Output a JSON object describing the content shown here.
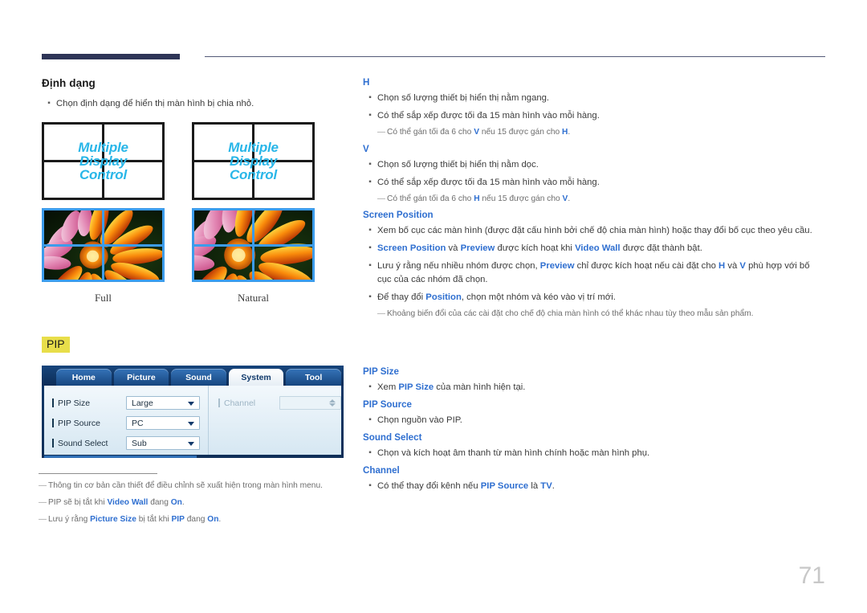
{
  "page": {
    "number": "71"
  },
  "left_column": {
    "section_title": "Định dạng",
    "bullets": [
      "Chọn định dạng để hiển thị màn hình bị chia nhỏ."
    ],
    "figure": {
      "wall_text_lines": [
        "Multiple",
        "Display",
        "Control"
      ],
      "captions": [
        "Full",
        "Natural"
      ]
    },
    "pip_badge": "PIP",
    "osd": {
      "tabs": [
        {
          "label": "Home",
          "active": false
        },
        {
          "label": "Picture",
          "active": false
        },
        {
          "label": "Sound",
          "active": false
        },
        {
          "label": "System",
          "active": true
        },
        {
          "label": "Tool",
          "active": false
        }
      ],
      "rows_left": [
        {
          "label": "PIP Size",
          "value": "Large"
        },
        {
          "label": "PIP Source",
          "value": "PC"
        },
        {
          "label": "Sound Select",
          "value": "Sub"
        }
      ],
      "rows_right": [
        {
          "label": "Channel",
          "value": ""
        }
      ]
    },
    "footnotes": [
      [
        {
          "t": "Thông tin cơ bản cần thiết để điều chỉnh sẽ xuất hiện trong màn hình menu.",
          "b": false
        }
      ],
      [
        {
          "t": "PIP sẽ bị tắt khi ",
          "b": false
        },
        {
          "t": "Video Wall",
          "b": true
        },
        {
          "t": " đang ",
          "b": false
        },
        {
          "t": "On",
          "b": true
        },
        {
          "t": ".",
          "b": false
        }
      ],
      [
        {
          "t": "Lưu ý rằng ",
          "b": false
        },
        {
          "t": "Picture Size",
          "b": true
        },
        {
          "t": " bị tắt khi ",
          "b": false
        },
        {
          "t": "PIP",
          "b": true
        },
        {
          "t": " đang ",
          "b": false
        },
        {
          "t": "On",
          "b": true
        },
        {
          "t": ".",
          "b": false
        }
      ]
    ]
  },
  "right_column": {
    "blocks": [
      {
        "heading": "H",
        "bullets": [
          [
            {
              "t": "Chọn số lượng thiết bị hiển thị nằm ngang.",
              "b": false
            }
          ],
          [
            {
              "t": "Có thể sắp xếp được tối đa 15 màn hình vào mỗi hàng.",
              "b": false
            }
          ]
        ],
        "notes": [
          [
            {
              "t": "Có thể gán tối đa 6 cho ",
              "b": false
            },
            {
              "t": "V",
              "b": true
            },
            {
              "t": " nếu 15 được gán cho ",
              "b": false
            },
            {
              "t": "H",
              "b": true
            },
            {
              "t": ".",
              "b": false
            }
          ]
        ]
      },
      {
        "heading": "V",
        "bullets": [
          [
            {
              "t": "Chọn số lượng thiết bị hiển thị nằm dọc.",
              "b": false
            }
          ],
          [
            {
              "t": "Có thể sắp xếp được tối đa 15 màn hình vào mỗi hàng.",
              "b": false
            }
          ]
        ],
        "notes": [
          [
            {
              "t": "Có thể gán tối đa 6 cho ",
              "b": false
            },
            {
              "t": "H",
              "b": true
            },
            {
              "t": " nếu 15 được gán cho ",
              "b": false
            },
            {
              "t": "V",
              "b": true
            },
            {
              "t": ".",
              "b": false
            }
          ]
        ]
      },
      {
        "heading": "Screen Position",
        "bullets": [
          [
            {
              "t": "Xem bố cục các màn hình (được đặt cấu hình bởi chế độ chia màn hình) hoặc thay đổi bố cục theo yêu cầu.",
              "b": false
            }
          ],
          [
            {
              "t": "Screen Position",
              "b": true
            },
            {
              "t": " và ",
              "b": false
            },
            {
              "t": "Preview",
              "b": true
            },
            {
              "t": " được kích hoạt khi ",
              "b": false
            },
            {
              "t": "Video Wall",
              "b": true
            },
            {
              "t": " được đặt thành bật.",
              "b": false
            }
          ],
          [
            {
              "t": "Lưu ý rằng nếu nhiều nhóm được chọn, ",
              "b": false
            },
            {
              "t": "Preview",
              "b": true
            },
            {
              "t": " chỉ được kích hoạt nếu cài đặt cho ",
              "b": false
            },
            {
              "t": "H",
              "b": true
            },
            {
              "t": " và ",
              "b": false
            },
            {
              "t": "V",
              "b": true
            },
            {
              "t": " phù hợp với bố cục của các nhóm đã chọn.",
              "b": false
            }
          ],
          [
            {
              "t": "Để thay đổi ",
              "b": false
            },
            {
              "t": "Position",
              "b": true
            },
            {
              "t": ", chọn một nhóm và kéo vào vị trí mới.",
              "b": false
            }
          ]
        ],
        "notes": [
          [
            {
              "t": "Khoảng biến đổi của các cài đặt cho chế độ chia màn hình có thể khác nhau tùy theo mẫu sản phẩm.",
              "b": false
            }
          ]
        ]
      }
    ],
    "pip_blocks": [
      {
        "heading": "PIP Size",
        "bullets": [
          [
            {
              "t": "Xem ",
              "b": false
            },
            {
              "t": "PIP Size",
              "b": true
            },
            {
              "t": " của màn hình hiện tại.",
              "b": false
            }
          ]
        ],
        "notes": []
      },
      {
        "heading": "PIP Source",
        "bullets": [
          [
            {
              "t": "Chọn nguồn vào PIP.",
              "b": false
            }
          ]
        ],
        "notes": []
      },
      {
        "heading": "Sound Select",
        "bullets": [
          [
            {
              "t": "Chọn và kích hoạt âm thanh từ màn hình chính hoặc màn hình phụ.",
              "b": false
            }
          ]
        ],
        "notes": []
      },
      {
        "heading": "Channel",
        "bullets": [
          [
            {
              "t": "Có thể thay đổi kênh nếu ",
              "b": false
            },
            {
              "t": "PIP Source",
              "b": true
            },
            {
              "t": " là ",
              "b": false
            },
            {
              "t": "TV",
              "b": true
            },
            {
              "t": ".",
              "b": false
            }
          ]
        ],
        "notes": []
      }
    ]
  },
  "colors": {
    "accent_navy": "#2e3557",
    "link_blue": "#2f6fd0",
    "highlight_yellow": "#e8de4a",
    "wall_text_cyan": "#29b6e8",
    "frame_blue": "#3c9ceb"
  }
}
